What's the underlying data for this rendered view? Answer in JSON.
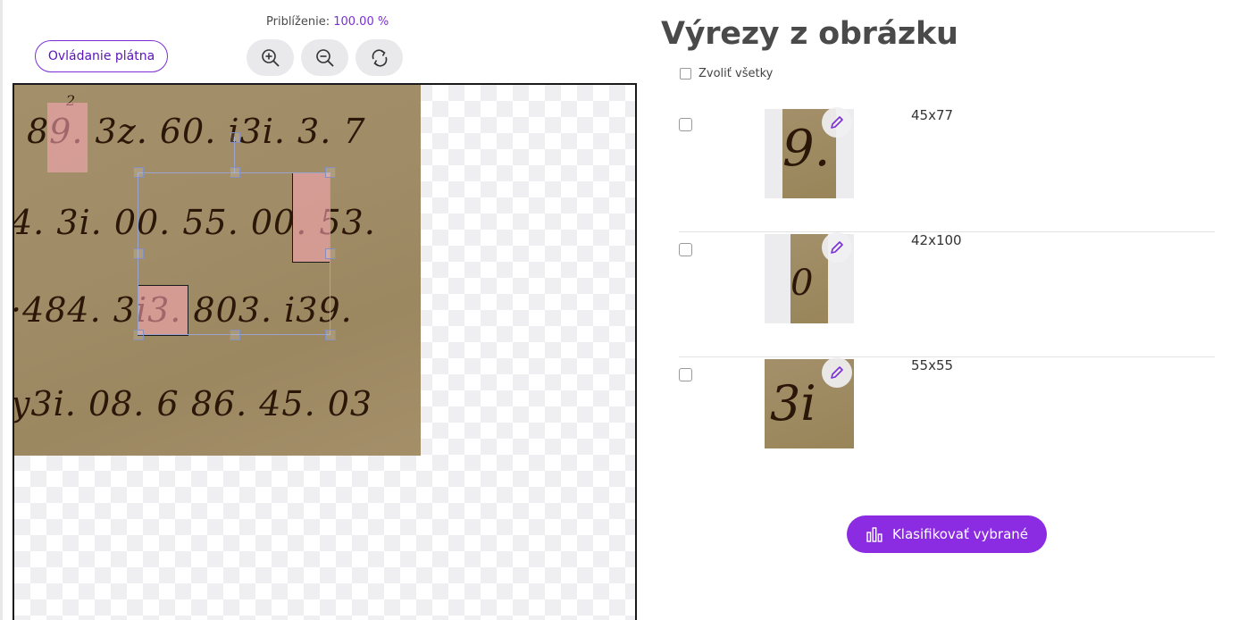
{
  "zoom": {
    "label": "Priblíženie:",
    "value": "100.00 %"
  },
  "canvas_controls_label": "Ovládanie plátna",
  "tools": {
    "zoom_in_icon": "zoom-in-icon",
    "zoom_out_icon": "zoom-out-icon",
    "reset_icon": "rotate-reset-icon"
  },
  "manuscript": {
    "lines": [
      "89. 3z. 60. i3i. 3. 7",
      "4. 3i. 00. 55. 00. 53.",
      "·484. 3i3. 803. i39.",
      "y3i. 08. 6 86. 45. 03"
    ],
    "superscript": "2"
  },
  "panel": {
    "title": "Výrezy z obrázku",
    "select_all_label": "Zvoliť všetky",
    "crops": [
      {
        "dims": "45x77",
        "thumb_text": "9."
      },
      {
        "dims": "42x100",
        "thumb_text": "0"
      },
      {
        "dims": "55x55",
        "thumb_text": "3i"
      }
    ]
  },
  "classify_label": "Klasifikovať vybrané",
  "colors": {
    "accent": "#8b2be2",
    "highlight": "#ffaab9"
  }
}
